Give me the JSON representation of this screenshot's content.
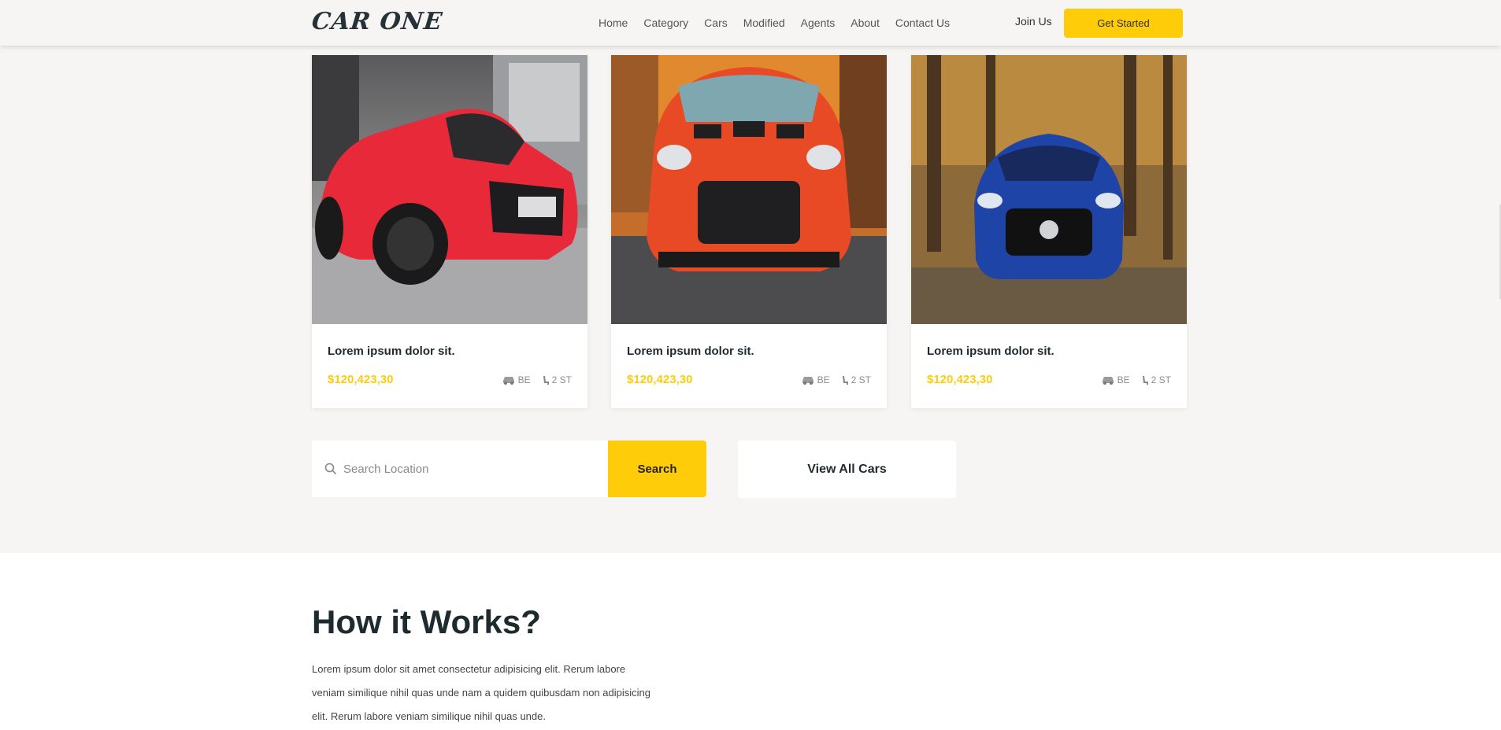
{
  "header": {
    "logo": "CAR ONE",
    "nav": [
      "Home",
      "Category",
      "Cars",
      "Modified",
      "Agents",
      "About",
      "Contact Us"
    ],
    "join": "Join Us",
    "cta": "Get Started"
  },
  "cards": [
    {
      "title": "Lorem ipsum dolor sit.",
      "price": "$120,423,30",
      "spec1": "BE",
      "spec2": "2 ST",
      "image": "red-mustang-photo"
    },
    {
      "title": "Lorem ipsum dolor sit.",
      "price": "$120,423,30",
      "spec1": "BE",
      "spec2": "2 ST",
      "image": "orange-gtr-photo"
    },
    {
      "title": "Lorem ipsum dolor sit.",
      "price": "$120,423,30",
      "spec1": "BE",
      "spec2": "2 ST",
      "image": "blue-mercedes-photo"
    }
  ],
  "search": {
    "placeholder": "Search Location",
    "button": "Search",
    "view_all": "View All Cars"
  },
  "how": {
    "title": "How it Works?",
    "text": "Lorem ipsum dolor sit amet consectetur adipisicing elit. Rerum labore veniam similique nihil quas unde nam a quidem quibusdam non adipisicing elit. Rerum labore veniam similique nihil quas unde."
  },
  "colors": {
    "accent": "#ffcc0a",
    "text": "#1d2b2f",
    "bg": "#f6f5f3"
  }
}
